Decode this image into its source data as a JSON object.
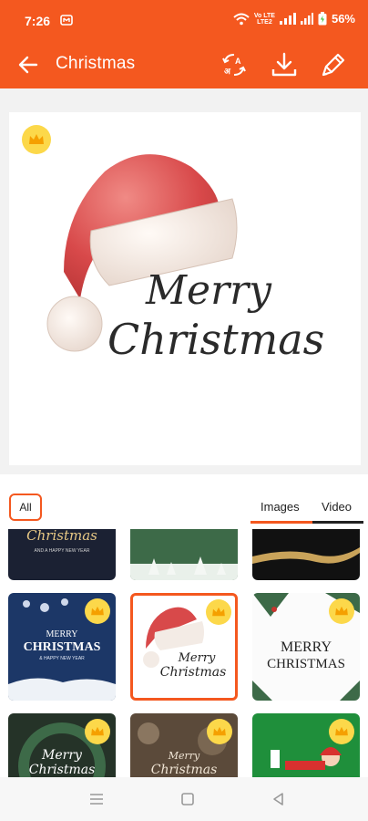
{
  "status": {
    "time": "7:26",
    "lte_top": "Vo LTE",
    "lte_bottom": "LTE2",
    "battery": "56%"
  },
  "appbar": {
    "title": "Christmas",
    "icons": [
      "back-arrow-icon",
      "translate-icon",
      "download-icon",
      "edit-pen-icon"
    ]
  },
  "preview": {
    "greeting_line1": "Merry",
    "greeting_line2": "Christmas",
    "premium_badge": "crown-icon"
  },
  "filters": {
    "all_label": "All",
    "tabs": [
      {
        "label": "Images",
        "active": true
      },
      {
        "label": "Video",
        "active": false
      }
    ]
  },
  "grid": {
    "rows": [
      [
        {
          "text": "Christmas",
          "sub": "AND A HAPPY NEW YEAR",
          "theme": "navy"
        },
        {
          "text": "",
          "theme": "green"
        },
        {
          "text": "",
          "theme": "black-gold"
        }
      ],
      [
        {
          "text": "MERRY",
          "text2": "CHRISTMAS",
          "sub": "& HAPPY NEW YEAR",
          "theme": "blue",
          "premium": true
        },
        {
          "text": "Merry",
          "text2": "Christmas",
          "theme": "white-hat",
          "premium": true,
          "selected": true
        },
        {
          "text": "MERRY",
          "text2": "CHRISTMAS",
          "theme": "white-pine",
          "premium": true
        }
      ],
      [
        {
          "text": "Merry",
          "text2": "Christmas",
          "theme": "dark-wreath",
          "premium": true
        },
        {
          "text": "Merry",
          "text2": "Christmas",
          "theme": "bokeh",
          "premium": true
        },
        {
          "text": "",
          "theme": "green-santa",
          "premium": true
        }
      ]
    ]
  },
  "colors": {
    "accent": "#f4581f",
    "crown": "#fcd84a"
  }
}
